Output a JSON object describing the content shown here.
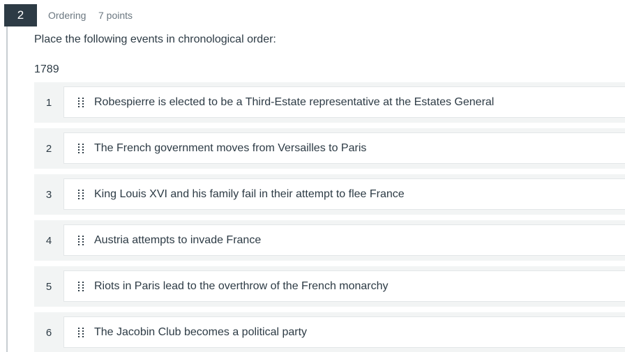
{
  "question": {
    "number": "2",
    "type": "Ordering",
    "points": "7 points",
    "prompt": "Place the following events in chronological order:",
    "start_label": "1789"
  },
  "items": [
    {
      "position": "1",
      "text": "Robespierre is elected to be a Third-Estate representative at the Estates General"
    },
    {
      "position": "2",
      "text": "The French government moves from Versailles to Paris"
    },
    {
      "position": "3",
      "text": "King Louis XVI and his family fail in their attempt to flee France"
    },
    {
      "position": "4",
      "text": "Austria attempts to invade France"
    },
    {
      "position": "5",
      "text": "Riots in Paris lead to the overthrow of the French monarchy"
    },
    {
      "position": "6",
      "text": "The Jacobin Club becomes a political party"
    }
  ]
}
